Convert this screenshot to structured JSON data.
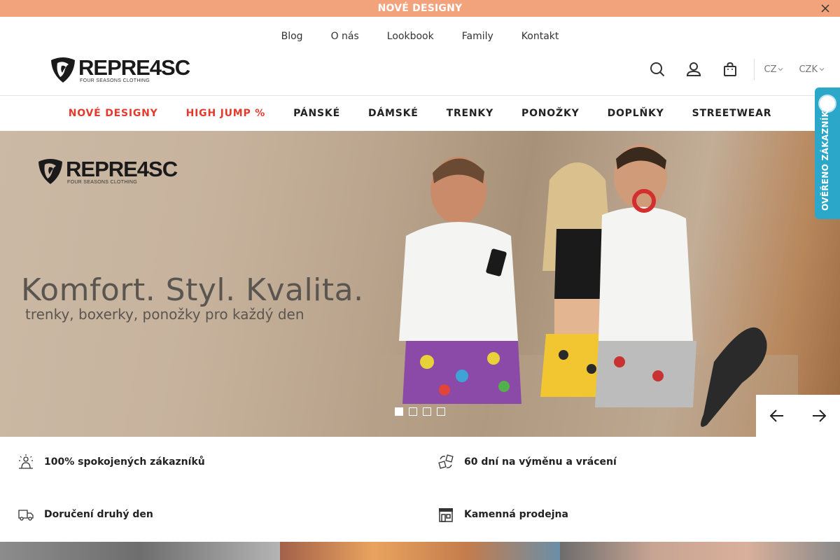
{
  "announcement": {
    "text": "NOVÉ DESIGNY"
  },
  "sublinks": [
    "Blog",
    "O nás",
    "Lookbook",
    "Family",
    "Kontakt"
  ],
  "logo": {
    "word": "REPRE4SC",
    "sub": "FOUR SEASONS CLOTHING"
  },
  "header": {
    "lang": "CZ",
    "currency": "CZK"
  },
  "nav": [
    {
      "label": "NOVÉ DESIGNY",
      "accent": true
    },
    {
      "label": "HIGH JUMP %",
      "accent": true
    },
    {
      "label": "PÁNSKÉ",
      "accent": false
    },
    {
      "label": "DÁMSKÉ",
      "accent": false
    },
    {
      "label": "TRENKY",
      "accent": false
    },
    {
      "label": "PONOŽKY",
      "accent": false
    },
    {
      "label": "DOPLŇKY",
      "accent": false
    },
    {
      "label": "STREETWEAR",
      "accent": false
    }
  ],
  "hero": {
    "title": "Komfort. Styl. Kvalita.",
    "subtitle": "trenky, boxerky, ponožky pro každý den",
    "slides": 4,
    "active_slide": 1
  },
  "badge": {
    "text": "OVĚŘENO ZÁKAZNÍKY"
  },
  "features": [
    "100% spokojených zákazníků",
    "60 dní na výměnu a vrácení",
    "Doručení druhý den",
    "Kamenná prodejna"
  ],
  "colors": {
    "announcement_bg": "#f2a37c",
    "accent_red": "#e23b2e",
    "badge_bg": "#2aa7c9"
  }
}
